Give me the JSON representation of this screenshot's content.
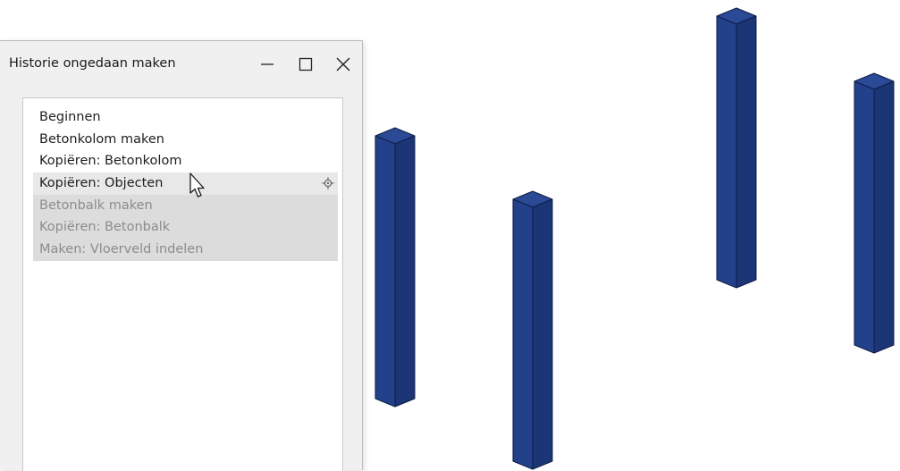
{
  "window": {
    "title": "Historie ongedaan maken",
    "buttons": {
      "minimize_icon": "minimize-icon",
      "maximize_icon": "maximize-icon",
      "close_icon": "close-icon"
    }
  },
  "history": {
    "items": [
      {
        "label": "Beginnen",
        "state": "done"
      },
      {
        "label": "Betonkolom maken",
        "state": "done"
      },
      {
        "label": "Kopiëren: Betonkolom",
        "state": "done"
      },
      {
        "label": "Kopiëren: Objecten",
        "state": "current"
      },
      {
        "label": "Betonbalk maken",
        "state": "undone"
      },
      {
        "label": "Kopiëren: Betonbalk",
        "state": "undone"
      },
      {
        "label": "Maken: Vloerveld indelen",
        "state": "undone"
      }
    ],
    "current_item_icon": "target-pin-icon"
  },
  "viewport": {
    "column_color_front": "#1f3c86",
    "column_color_side": "#1a3373",
    "column_color_top": "#2a4a96",
    "column_count": 4
  },
  "colors": {
    "undone_text": "#8c8c8c",
    "current_bg": "#e8e8e8",
    "undone_bg": "#dcdcdc"
  }
}
